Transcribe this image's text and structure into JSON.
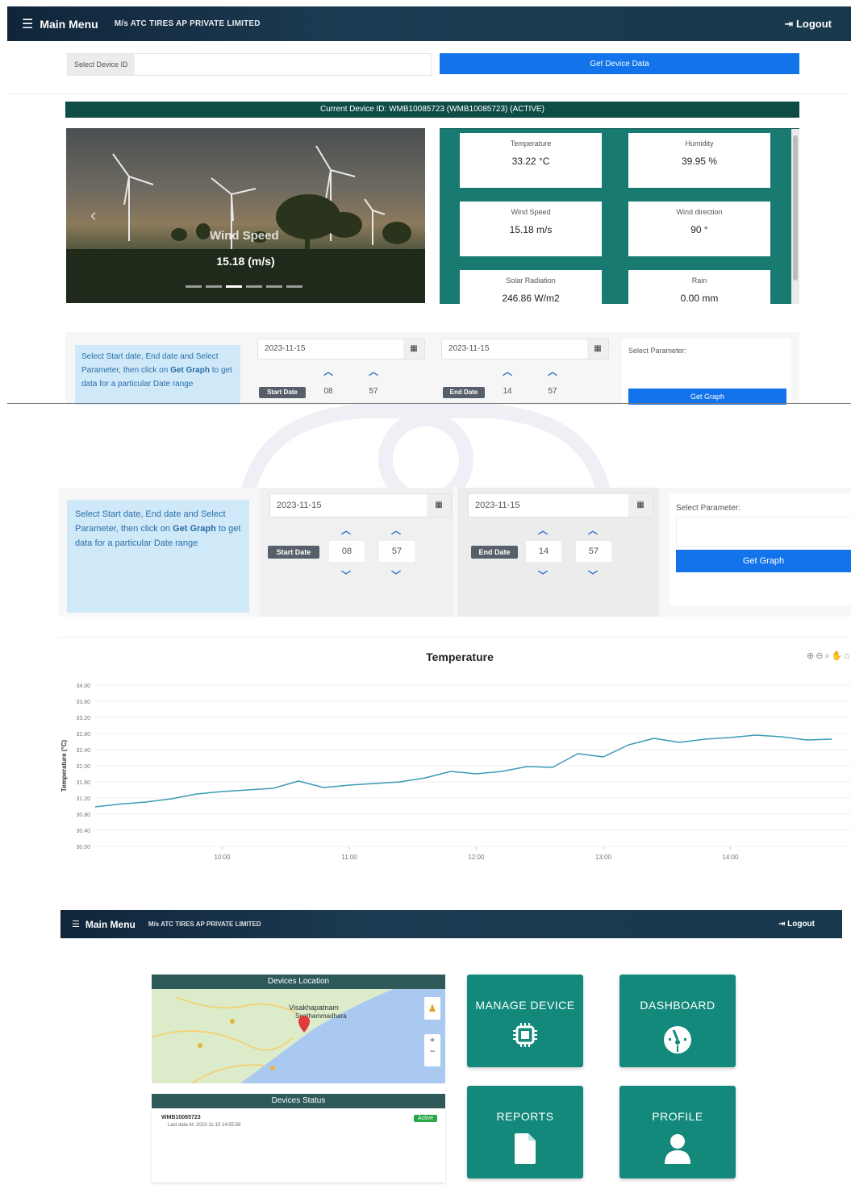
{
  "topnav": {
    "menu_label": "Main Menu",
    "company": "M/s ATC TIRES AP PRIVATE LIMITED",
    "logout": "Logout"
  },
  "device_select": {
    "label": "Select Device ID",
    "button": "Get Device Data"
  },
  "current_device": "Current Device ID: WMB10085723 (WMB10085723) (ACTIVE)",
  "carousel": {
    "title": "Wind Speed",
    "value": "15.18 (m/s)",
    "indicator_count": 6,
    "active_index": 2
  },
  "sensors": [
    {
      "name": "Temperature",
      "value": "33.22 °C"
    },
    {
      "name": "Humidity",
      "value": "39.95 %"
    },
    {
      "name": "Wind Speed",
      "value": "15.18 m/s"
    },
    {
      "name": "Wind direction",
      "value": "90 °"
    },
    {
      "name": "Solar Radiation",
      "value": "246.86 W/m2"
    },
    {
      "name": "Rain",
      "value": "0.00 mm"
    }
  ],
  "filter_small": {
    "info_pre": "Select Start date, End date and Select Parameter, then click on ",
    "info_bold": "Get Graph",
    "info_post": " to get data for a particular Date range",
    "start_date": "2023-11-15",
    "end_date": "2023-11-15",
    "start_tag": "Start Date",
    "end_tag": "End Date",
    "start_hour": "08",
    "start_min": "57",
    "end_hour": "14",
    "end_min": "57",
    "param_label": "Select Parameter:",
    "button": "Get Graph"
  },
  "filter_big": {
    "info_pre": "Select Start date, End date and Select Parameter, then click on ",
    "info_bold": "Get Graph",
    "info_post": " to get data for a particular Date range",
    "start_date": "2023-11-15",
    "end_date": "2023-11-15",
    "start_tag": "Start Date",
    "end_tag": "End Date",
    "start_hour": "08",
    "start_min": "57",
    "end_hour": "14",
    "end_min": "57",
    "param_label": "Select Parameter:",
    "button": "Get Graph"
  },
  "chart_data": {
    "type": "line",
    "title": "Temperature",
    "ylabel": "Temperature (°C)",
    "y_ticks": [
      "34.00",
      "33.60",
      "33.20",
      "32.80",
      "32.40",
      "32.00",
      "31.60",
      "31.20",
      "30.80",
      "30.40",
      "30.00"
    ],
    "x_ticks": [
      "10:00",
      "11:00",
      "12:00",
      "13:00",
      "14:00"
    ],
    "ylim": [
      30.0,
      34.0
    ],
    "x": [
      9.0,
      9.2,
      9.4,
      9.6,
      9.8,
      10.0,
      10.2,
      10.4,
      10.6,
      10.8,
      11.0,
      11.2,
      11.4,
      11.6,
      11.8,
      12.0,
      12.2,
      12.4,
      12.6,
      12.8,
      13.0,
      13.2,
      13.4,
      13.6,
      13.8,
      14.0,
      14.2,
      14.4,
      14.6,
      14.8
    ],
    "series": [
      {
        "values": [
          30.98,
          31.05,
          31.1,
          31.18,
          31.3,
          31.36,
          31.4,
          31.44,
          31.62,
          31.46,
          31.52,
          31.56,
          31.6,
          31.7,
          31.86,
          31.8,
          31.86,
          31.98,
          31.96,
          32.3,
          32.22,
          32.52,
          32.68,
          32.58,
          32.66,
          32.7,
          32.76,
          32.72,
          32.64,
          32.66
        ]
      }
    ],
    "grid": true
  },
  "nav2": {
    "menu_label": "Main Menu",
    "company": "M/s ATC TIRES AP PRIVATE LIMITED",
    "logout": "Logout"
  },
  "map": {
    "title": "Devices Location",
    "place1": "Visakhapatnam",
    "place2": "Seethammadhara",
    "zoom_in": "+",
    "zoom_out": "−"
  },
  "status": {
    "title": "Devices Status",
    "device_id": "WMB10085723",
    "last_data": "Last data At: 2023-11-15 14:55:58",
    "badge": "Active"
  },
  "tiles": {
    "manage": "MANAGE DEVICE",
    "dashboard": "DASHBOARD",
    "reports": "REPORTS",
    "profile": "PROFILE"
  },
  "colors": {
    "nav": "#10253a",
    "accent_blue": "#1273ea",
    "teal": "#13897c",
    "line": "#3a9bb5"
  }
}
